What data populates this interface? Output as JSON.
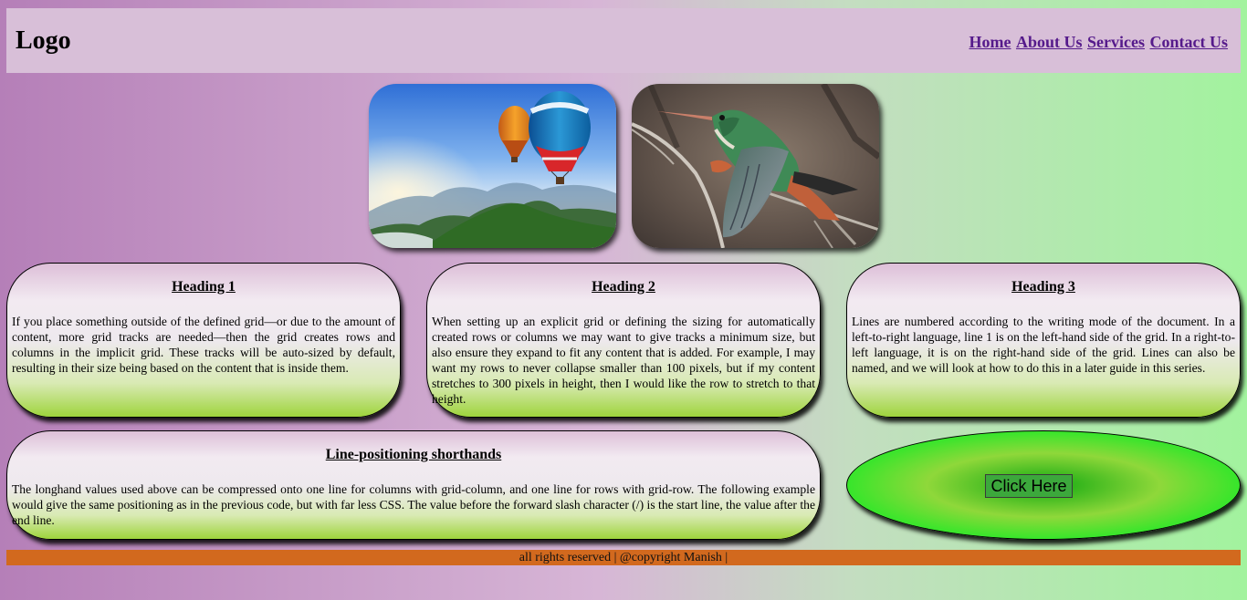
{
  "header": {
    "logo": "Logo",
    "nav": [
      "Home",
      "About Us",
      "Services",
      "Contact Us"
    ]
  },
  "photos": [
    {
      "name": "hot-air-balloons"
    },
    {
      "name": "hummingbird"
    }
  ],
  "cards": [
    {
      "heading": "Heading 1",
      "text": "If you place something outside of the defined grid—or due to the amount of content, more grid tracks are needed—then the grid creates rows and columns in the implicit grid. These tracks will be auto-sized by default, resulting in their size being based on the content that is inside them."
    },
    {
      "heading": "Heading 2",
      "text": "When setting up an explicit grid or defining the sizing for automatically created rows or columns we may want to give tracks a minimum size, but also ensure they expand to fit any content that is added. For example, I may want my rows to never collapse smaller than 100 pixels, but if my content stretches to 300 pixels in height, then I would like the row to stretch to that height."
    },
    {
      "heading": "Heading 3",
      "text": "Lines are numbered according to the writing mode of the document. In a left-to-right language, line 1 is on the left-hand side of the grid. In a right-to-left language, it is on the right-hand side of the grid. Lines can also be named, and we will look at how to do this in a later guide in this series."
    },
    {
      "heading": "Line-positioning shorthands",
      "text": "The longhand values used above can be compressed onto one line for columns with grid-column, and one line for rows with grid-row. The following example would give the same positioning as in the previous code, but with far less CSS. The value before the forward slash character (/) is the start line, the value after the end line."
    }
  ],
  "cta": {
    "button_label": "Click Here"
  },
  "footer": {
    "text": "all rights reserved | @copyright Manish |"
  },
  "colors": {
    "header_bg": "#d8bfd8",
    "footer_bg": "#d2691e",
    "link": "#551a8b",
    "cta_green": "#17e31a"
  }
}
